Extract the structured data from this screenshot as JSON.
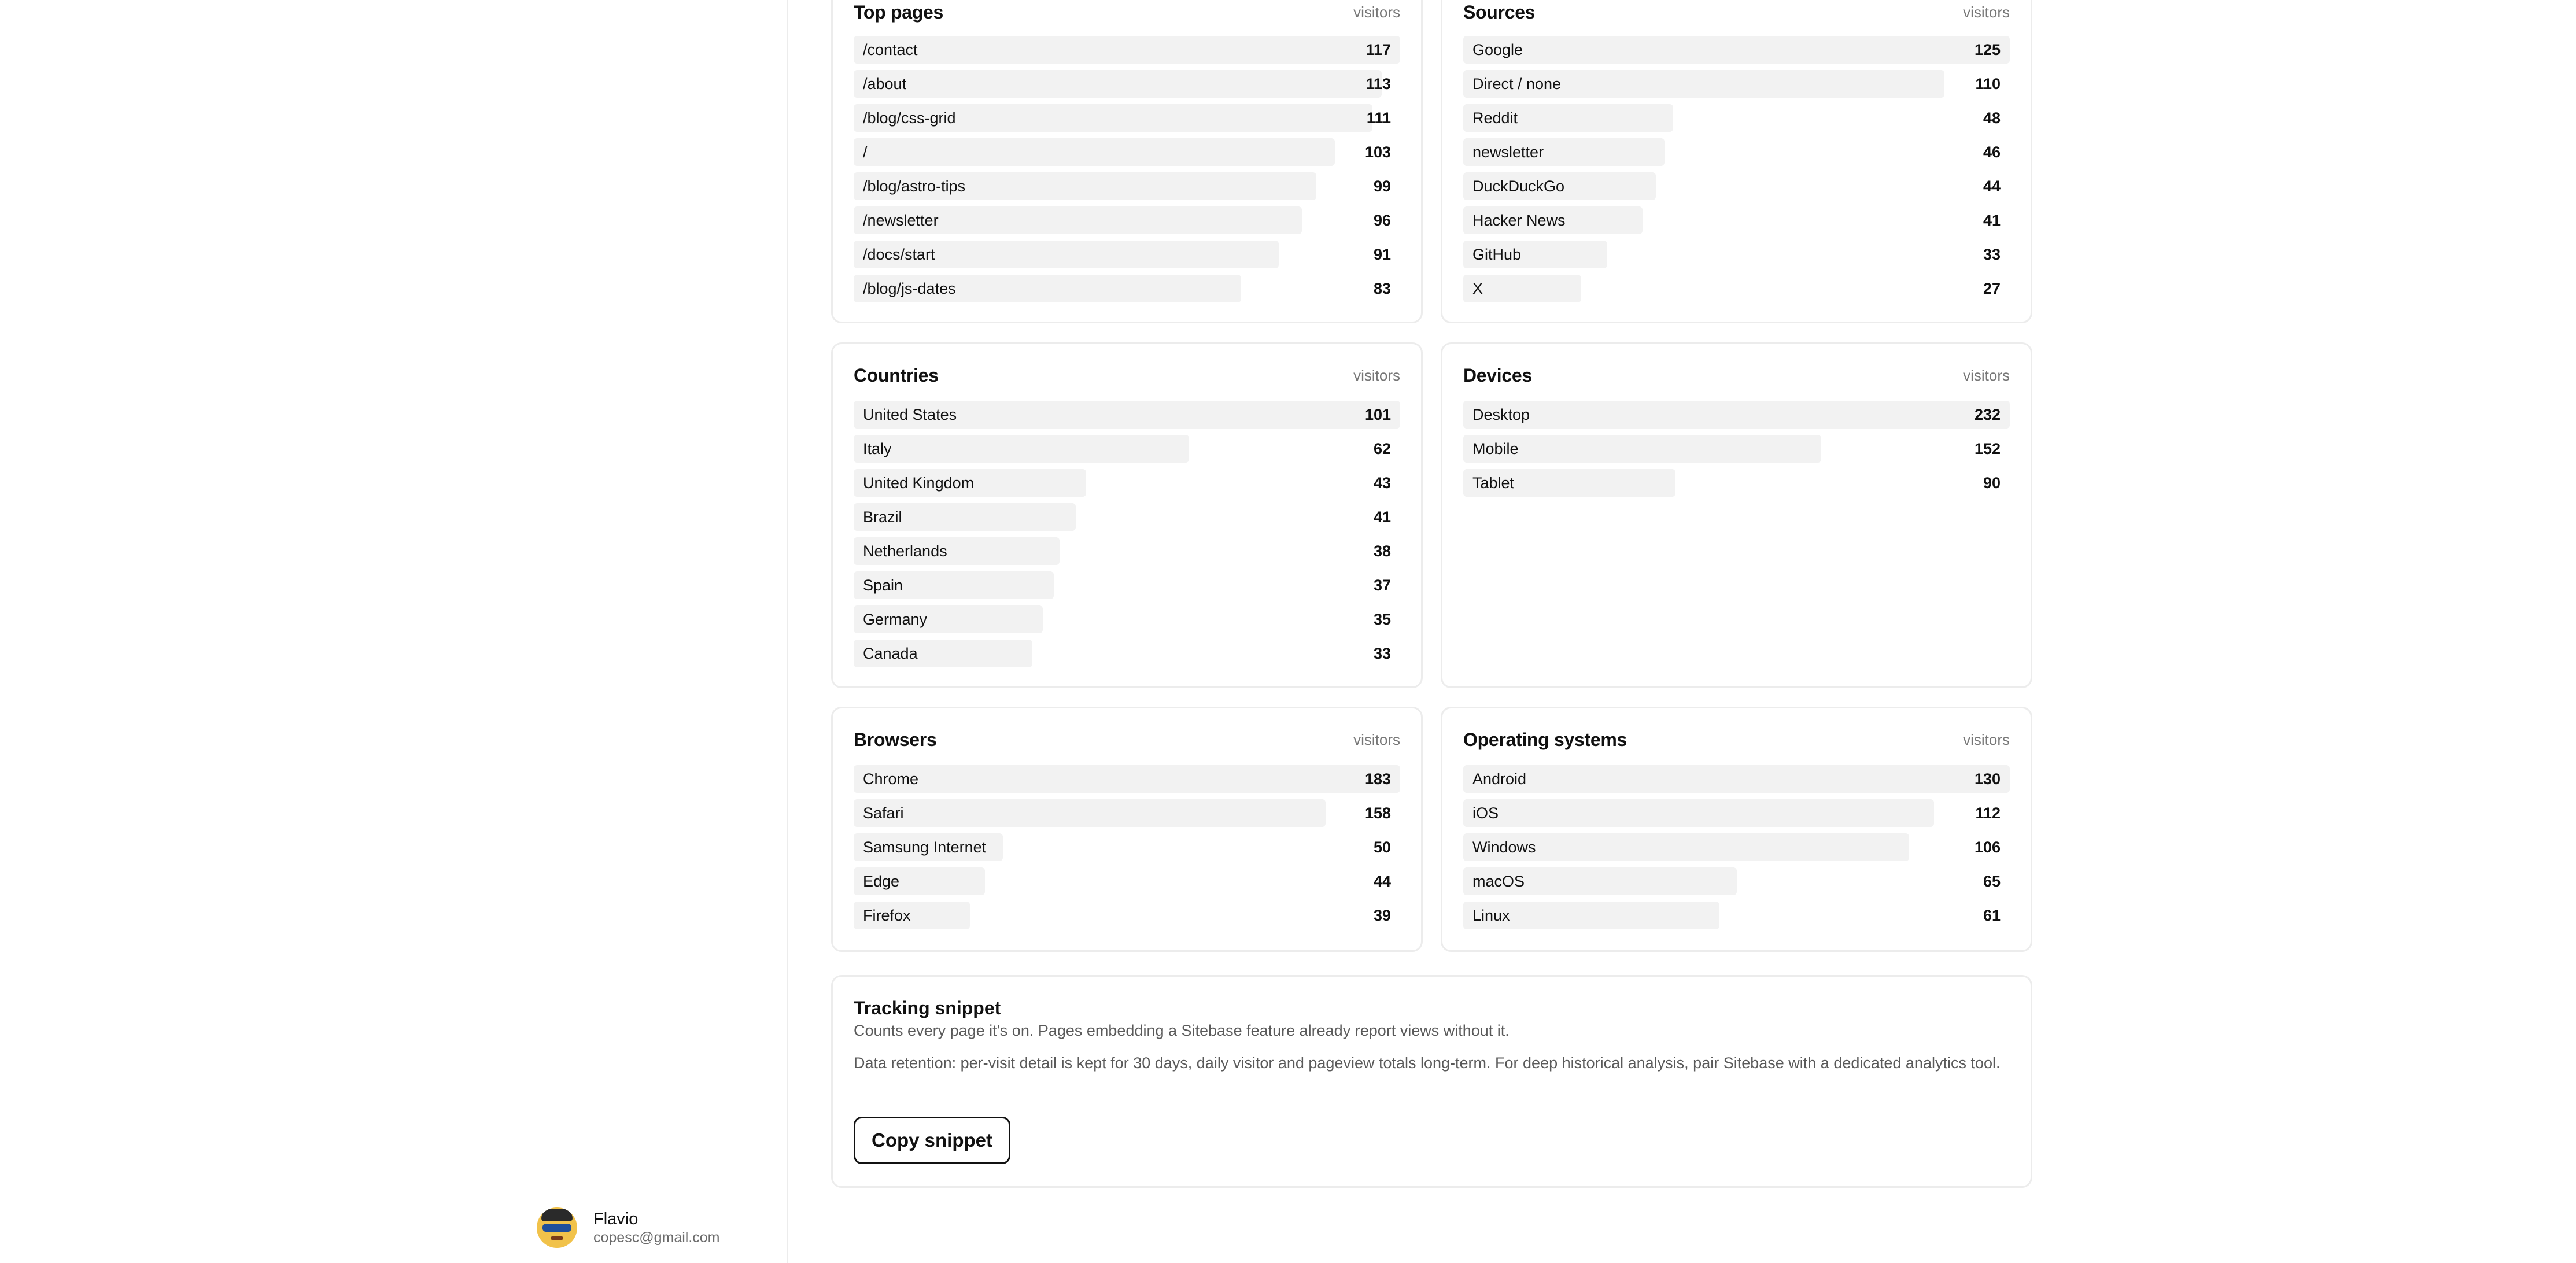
{
  "user": {
    "name": "Flavio",
    "email": "copesc@gmail.com"
  },
  "cards": {
    "top_pages": {
      "title": "Top pages",
      "subtitle": "visitors",
      "rows": [
        {
          "label": "/contact",
          "value": 117
        },
        {
          "label": "/about",
          "value": 113
        },
        {
          "label": "/blog/css-grid",
          "value": 111
        },
        {
          "label": "/",
          "value": 103
        },
        {
          "label": "/blog/astro-tips",
          "value": 99
        },
        {
          "label": "/newsletter",
          "value": 96
        },
        {
          "label": "/docs/start",
          "value": 91
        },
        {
          "label": "/blog/js-dates",
          "value": 83
        }
      ]
    },
    "sources": {
      "title": "Sources",
      "subtitle": "visitors",
      "rows": [
        {
          "label": "Google",
          "value": 125
        },
        {
          "label": "Direct / none",
          "value": 110
        },
        {
          "label": "Reddit",
          "value": 48
        },
        {
          "label": "newsletter",
          "value": 46
        },
        {
          "label": "DuckDuckGo",
          "value": 44
        },
        {
          "label": "Hacker News",
          "value": 41
        },
        {
          "label": "GitHub",
          "value": 33
        },
        {
          "label": "X",
          "value": 27
        }
      ]
    },
    "countries": {
      "title": "Countries",
      "subtitle": "visitors",
      "rows": [
        {
          "label": "United States",
          "value": 101
        },
        {
          "label": "Italy",
          "value": 62
        },
        {
          "label": "United Kingdom",
          "value": 43
        },
        {
          "label": "Brazil",
          "value": 41
        },
        {
          "label": "Netherlands",
          "value": 38
        },
        {
          "label": "Spain",
          "value": 37
        },
        {
          "label": "Germany",
          "value": 35
        },
        {
          "label": "Canada",
          "value": 33
        }
      ]
    },
    "devices": {
      "title": "Devices",
      "subtitle": "visitors",
      "rows": [
        {
          "label": "Desktop",
          "value": 232
        },
        {
          "label": "Mobile",
          "value": 152
        },
        {
          "label": "Tablet",
          "value": 90
        }
      ]
    },
    "browsers": {
      "title": "Browsers",
      "subtitle": "visitors",
      "rows": [
        {
          "label": "Chrome",
          "value": 183
        },
        {
          "label": "Safari",
          "value": 158
        },
        {
          "label": "Samsung Internet",
          "value": 50
        },
        {
          "label": "Edge",
          "value": 44
        },
        {
          "label": "Firefox",
          "value": 39
        }
      ]
    },
    "operating_systems": {
      "title": "Operating systems",
      "subtitle": "visitors",
      "rows": [
        {
          "label": "Android",
          "value": 130
        },
        {
          "label": "iOS",
          "value": 112
        },
        {
          "label": "Windows",
          "value": 106
        },
        {
          "label": "macOS",
          "value": 65
        },
        {
          "label": "Linux",
          "value": 61
        }
      ]
    }
  },
  "snippet": {
    "title": "Tracking snippet",
    "description": "Counts every page it's on. Pages embedding a Sitebase feature already report views without it.",
    "retention_note": "Data retention: per-visit detail is kept for 30 days, daily visitor and pageview totals long-term. For deep historical analysis, pair Sitebase with a dedicated analytics tool.",
    "button_label": "Copy snippet"
  }
}
